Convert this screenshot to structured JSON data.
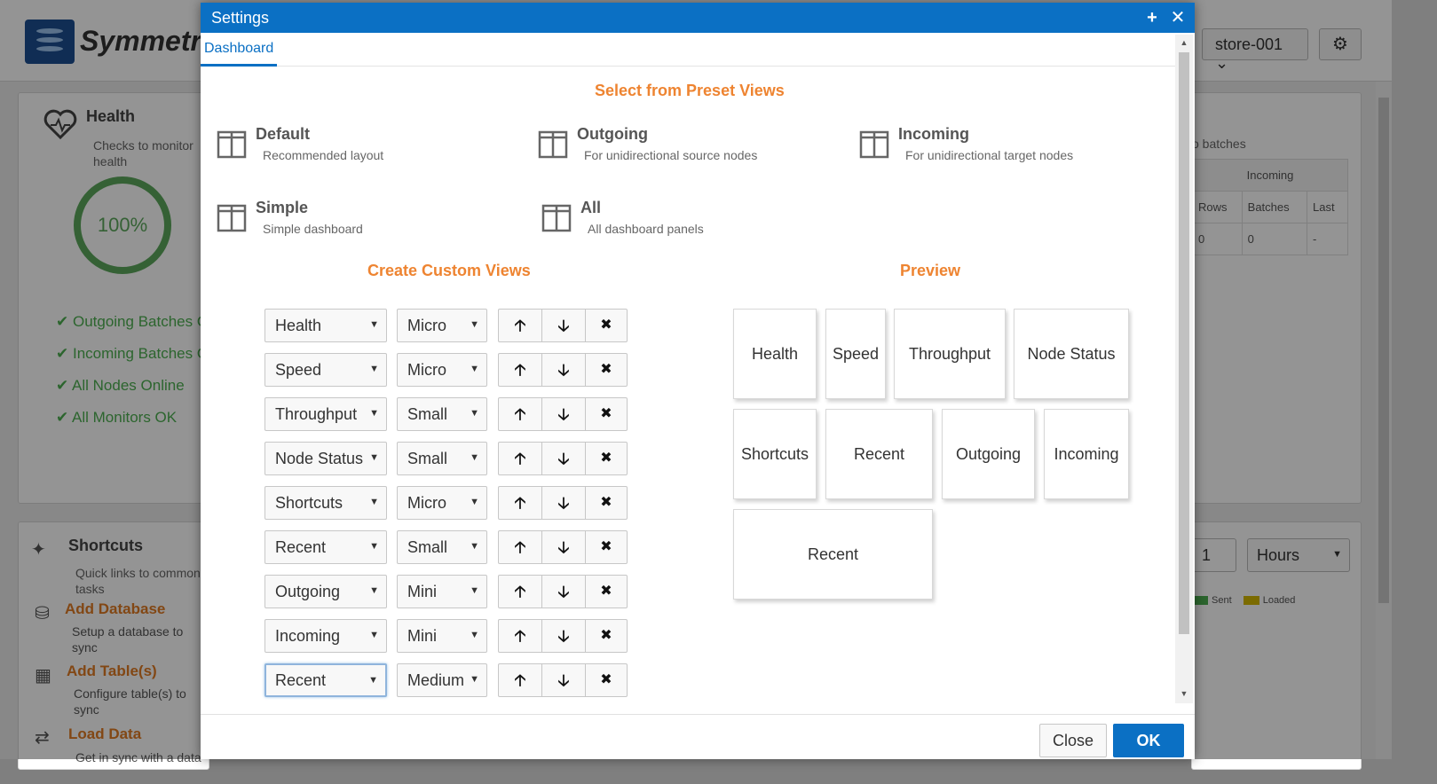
{
  "background": {
    "logo_text": "Symmetri",
    "store_select": "store-001",
    "health": {
      "title": "Health",
      "subtitle": "Checks to monitor health",
      "gauge_value": "100%",
      "checks": [
        "Outgoing Batches O",
        "Incoming Batches O",
        "All Nodes Online",
        "All Monitors OK"
      ]
    },
    "shortcuts": {
      "title": "Shortcuts",
      "subtitle": "Quick links to common tasks",
      "items": [
        {
          "label": "Add Database",
          "desc": "Setup a database to sync"
        },
        {
          "label": "Add Table(s)",
          "desc": "Configure table(s) to sync"
        },
        {
          "label": "Load Data",
          "desc": "Get in sync with a data"
        }
      ]
    },
    "right_panel": {
      "partial_text": "o batches",
      "incoming_header": "Incoming",
      "columns": [
        "Rows",
        "Batches",
        "Last"
      ],
      "values": [
        "0",
        "0",
        "-"
      ],
      "number_input": "1",
      "hours_select": "Hours",
      "legend": [
        {
          "name": "Sent",
          "color": "#4caf50"
        },
        {
          "name": "Loaded",
          "color": "#d4b800"
        }
      ]
    }
  },
  "modal": {
    "title": "Settings",
    "tab": "Dashboard",
    "preset_title": "Select from Preset Views",
    "presets": [
      {
        "name": "Default",
        "desc": "Recommended layout"
      },
      {
        "name": "Outgoing",
        "desc": "For unidirectional source nodes"
      },
      {
        "name": "Incoming",
        "desc": "For unidirectional target nodes"
      },
      {
        "name": "Simple",
        "desc": "Simple dashboard"
      },
      {
        "name": "All",
        "desc": "All dashboard panels"
      }
    ],
    "custom_title": "Create Custom Views",
    "preview_title": "Preview",
    "custom_rows": [
      {
        "panel": "Health",
        "size": "Micro"
      },
      {
        "panel": "Speed",
        "size": "Micro"
      },
      {
        "panel": "Throughput",
        "size": "Small"
      },
      {
        "panel": "Node Status",
        "size": "Small"
      },
      {
        "panel": "Shortcuts",
        "size": "Micro"
      },
      {
        "panel": "Recent",
        "size": "Small"
      },
      {
        "panel": "Outgoing",
        "size": "Mini"
      },
      {
        "panel": "Incoming",
        "size": "Mini"
      },
      {
        "panel": "Recent",
        "size": "Medium"
      }
    ],
    "preview_tiles": [
      "Health",
      "Speed",
      "Throughput",
      "Node Status",
      "Shortcuts",
      "Recent",
      "Outgoing",
      "Incoming",
      "Recent"
    ],
    "close_label": "Close",
    "ok_label": "OK",
    "accent_color": "#0b70c4",
    "heading_color": "#ee8431"
  }
}
